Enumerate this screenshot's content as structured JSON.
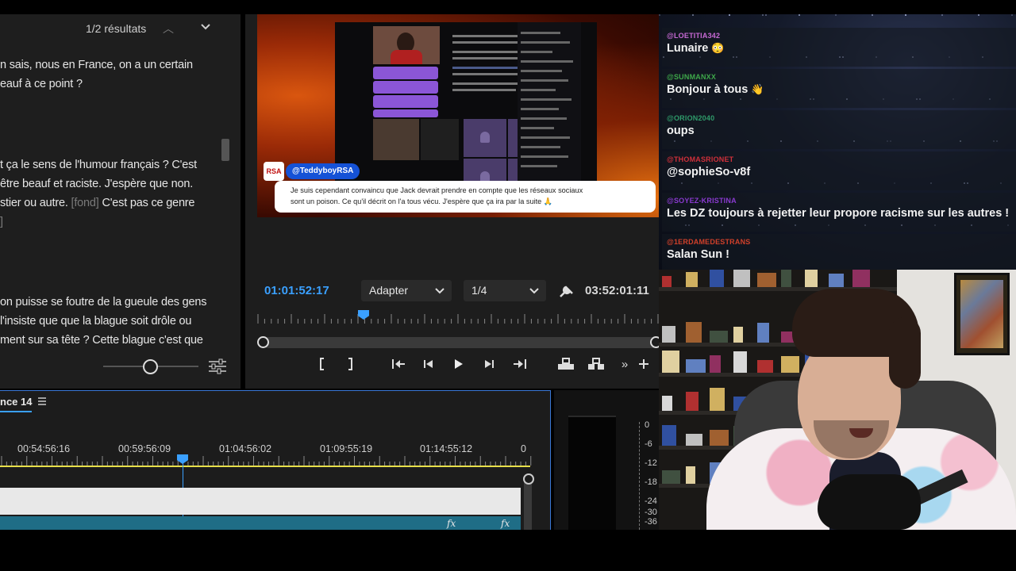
{
  "transcript": {
    "result_count": "1/2 résultats",
    "lines": [
      "n sais, nous en France, on a un certain",
      "eauf à ce point ?",
      "t ça le sens de l'humour français ? C'est",
      "être beauf et raciste. J'espère que non.",
      "stier ou autre.",
      "C'est pas ce genre",
      "]",
      "on puisse se foutre de la gueule des gens",
      "l'insiste que que la blague soit drôle ou",
      "ment sur sa tête ? Cette blague c'est que"
    ],
    "fond_label": "[fond]"
  },
  "monitor": {
    "caption_handle": "@TeddyboyRSA",
    "caption_badge": "RSA",
    "caption_text": "Je suis cependant convaincu que Jack devrait prendre en compte que les réseaux sociaux\nsont un poison. Ce qu'il décrit on l'a tous vécu. J'espère que ça ira par la suite 🙏",
    "timecode_current": "01:01:52:17",
    "fit_value": "Adapter",
    "quality_value": "1/4",
    "timecode_duration": "03:52:01:11"
  },
  "timeline": {
    "sequence_tab": "nce 14",
    "ruler_labels": [
      "00:54:56:16",
      "00:59:56:09",
      "01:04:56:02",
      "01:09:55:19",
      "01:14:55:12",
      "0"
    ],
    "fx_label": "fx"
  },
  "meters": {
    "labels": [
      "0",
      "-6",
      "-12",
      "-18",
      "-24",
      "-30",
      "-36"
    ]
  },
  "chat": {
    "messages": [
      {
        "user": "@LOETITIA342",
        "text": "Lunaire",
        "emoji": "😳",
        "color": "#c86ad6"
      },
      {
        "user": "@SUNMANXX",
        "text": "Bonjour à tous",
        "emoji": "👋",
        "color": "#3ea84a"
      },
      {
        "user": "@ORION2040",
        "text": "oups",
        "emoji": "",
        "color": "#2f9b6a"
      },
      {
        "user": "@THOMASRIONET",
        "text": "@sophieSo-v8f",
        "emoji": "",
        "color": "#d0303a"
      },
      {
        "user": "@SOYEZ-KRISTINA",
        "text": "Les DZ toujours à rejetter leur propore racisme sur les autres !",
        "emoji": "",
        "color": "#8a3ad0"
      },
      {
        "user": "@1ERDAMEDESTRANS",
        "text": "Salan Sun !",
        "emoji": "",
        "color": "#d0402a"
      }
    ]
  },
  "colors": {
    "accent_blue": "#3aa0ff",
    "timeline_border": "#3a78d8",
    "track_teal": "#1f6d86",
    "range_yellow": "#e8e04a"
  },
  "icons": [
    "chevron-up-icon",
    "chevron-down-icon",
    "settings-sliders-icon",
    "wrench-icon",
    "mark-in-icon",
    "mark-out-icon",
    "go-to-in-icon",
    "step-back-icon",
    "play-icon",
    "step-forward-icon",
    "go-to-out-icon",
    "lift-icon",
    "extract-icon",
    "more-icon",
    "add-icon",
    "hamburger-menu-icon"
  ]
}
